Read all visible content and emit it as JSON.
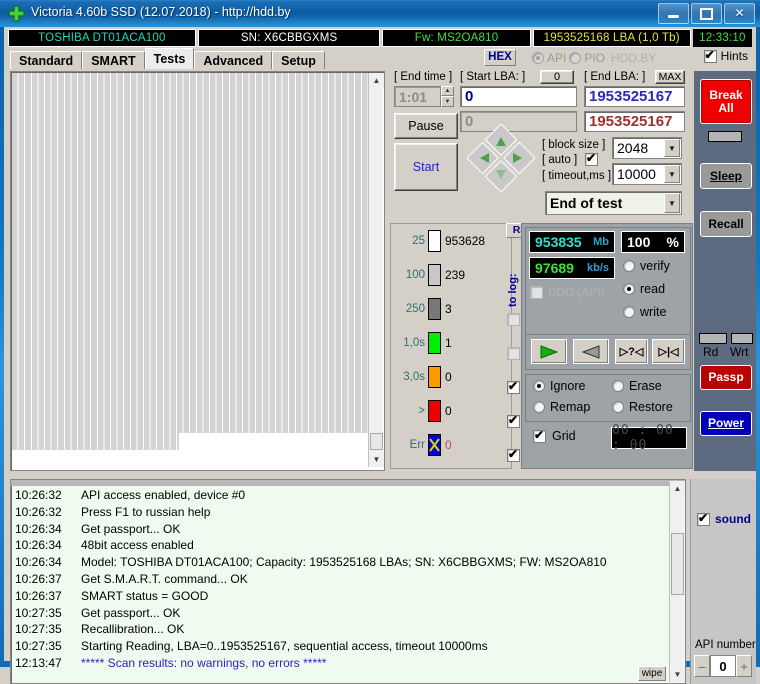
{
  "window": {
    "title": "Victoria 4.60b SSD (12.07.2018) - http://hdd.by",
    "icon": "plus-cross-icon",
    "minimize": "minimize-icon",
    "maximize": "maximize-icon",
    "close": "close-icon"
  },
  "info_strip": {
    "model": "TOSHIBA DT01ACA100",
    "serial": "SN: X6CBBGXMS",
    "firmware": "Fw: MS2OA810",
    "capacity": "1953525168 LBA (1,0 Tb)",
    "clock": "12:33:10",
    "colors": {
      "model": "#27d6b8",
      "serial": "#ffffff",
      "firmware": "#3fdf3f",
      "capacity": "#e2e24a",
      "clock": "#3fdf3f"
    }
  },
  "tabs": [
    {
      "label": "Standard",
      "active": false
    },
    {
      "label": "SMART",
      "active": false
    },
    {
      "label": "Tests",
      "active": true
    },
    {
      "label": "Advanced",
      "active": false
    },
    {
      "label": "Setup",
      "active": false
    }
  ],
  "toolbar": {
    "hex_label": "HEX",
    "api_label": "API",
    "pio_label": "PIO",
    "hddby_label": "HDD.BY",
    "api_selected": true,
    "pio_selected": false,
    "hints_label": "Hints",
    "hints_checked": true
  },
  "params": {
    "end_time_label": "[ End time ]",
    "end_time_value": "1:01",
    "start_lba_label": "[ Start LBA: ]",
    "start_lba_button": "0",
    "start_lba_value": "0",
    "start_lba_secondary": "0",
    "end_lba_label": "[ End LBA: ]",
    "end_lba_max_button": "MAX",
    "end_lba_value": "1953525167",
    "end_lba_secondary": "1953525167",
    "pause_label": "Pause",
    "start_label": "Start",
    "block_size_label": "[ block size ]",
    "auto_label": "[ auto ]",
    "auto_checked": true,
    "block_size_value": "2048",
    "timeout_label": "[ timeout,ms ]",
    "timeout_value": "10000",
    "end_action_value": "End of test"
  },
  "stats": {
    "rows": [
      {
        "threshold": "25",
        "color": "#ffffff",
        "count": "953628",
        "tolog": null
      },
      {
        "threshold": "100",
        "color": "#c8c8c8",
        "count": "239",
        "tolog": null
      },
      {
        "threshold": "250",
        "color": "#787878",
        "count": "3",
        "tolog": false
      },
      {
        "threshold": "1,0s",
        "color": "#00ee00",
        "count": "1",
        "tolog": false
      },
      {
        "threshold": "3,0s",
        "color": "#ff9900",
        "count": "0",
        "tolog": true
      },
      {
        "threshold": ">",
        "color": "#ee0000",
        "count": "0",
        "tolog": true
      },
      {
        "threshold": "Err",
        "color": "#0000dd",
        "count": "0",
        "tolog": true
      }
    ],
    "rs_button": "RS",
    "to_log_label": "to log:"
  },
  "metrics": {
    "size_value": "953835",
    "size_unit": "Mb",
    "percent_value": "100",
    "percent_unit": "%",
    "speed_value": "97689",
    "speed_unit": "kb/s",
    "ddd_label": "DDD (API)",
    "ddd_checked": false,
    "modes": [
      {
        "label": "verify",
        "selected": false
      },
      {
        "label": "read",
        "selected": true
      },
      {
        "label": "write",
        "selected": false
      }
    ],
    "nav_buttons": [
      {
        "name": "play-forward",
        "glyph": "▶"
      },
      {
        "name": "play-back",
        "glyph": "◀"
      },
      {
        "name": "random",
        "glyph": "▷?◁"
      },
      {
        "name": "butterfly",
        "glyph": "▷|◁"
      }
    ],
    "actions": [
      {
        "label": "Ignore",
        "selected": true
      },
      {
        "label": "Erase",
        "selected": false
      },
      {
        "label": "Remap",
        "selected": false
      },
      {
        "label": "Restore",
        "selected": false
      }
    ],
    "grid_label": "Grid",
    "grid_checked": true,
    "timer_display": "00 : 00 : 00"
  },
  "right_buttons": {
    "break_all": "Break\nAll",
    "break_all_line1": "Break",
    "break_all_line2": "All",
    "sleep": "Sleep",
    "recall": "Recall",
    "rd_label": "Rd",
    "wrt_label": "Wrt",
    "passp": "Passp",
    "power": "Power"
  },
  "log": {
    "lines": [
      {
        "time": "10:26:32",
        "msg": "API access enabled, device #0",
        "blue": false
      },
      {
        "time": "10:26:32",
        "msg": "Press F1 to russian help",
        "blue": false
      },
      {
        "time": "10:26:34",
        "msg": "Get passport... OK",
        "blue": false
      },
      {
        "time": "10:26:34",
        "msg": "48bit access enabled",
        "blue": false
      },
      {
        "time": "10:26:34",
        "msg": "Model: TOSHIBA DT01ACA100; Capacity: 1953525168 LBAs; SN: X6CBBGXMS; FW: MS2OA810",
        "blue": false
      },
      {
        "time": "10:26:37",
        "msg": "Get S.M.A.R.T. command... OK",
        "blue": false
      },
      {
        "time": "10:26:37",
        "msg": "SMART status = GOOD",
        "blue": false
      },
      {
        "time": "10:27:35",
        "msg": "Get passport... OK",
        "blue": false
      },
      {
        "time": "10:27:35",
        "msg": "Recallibration... OK",
        "blue": false
      },
      {
        "time": "10:27:35",
        "msg": "Starting Reading, LBA=0..1953525167, sequential access, timeout 10000ms",
        "blue": false
      },
      {
        "time": "12:13:47",
        "msg": "***** Scan results: no warnings, no errors *****",
        "blue": true
      }
    ],
    "wipe_label": "wipe"
  },
  "bottom_right": {
    "sound_label": "sound",
    "sound_checked": true,
    "api_number_label": "API number",
    "api_number_value": "0",
    "minus": "–",
    "plus": "+"
  }
}
